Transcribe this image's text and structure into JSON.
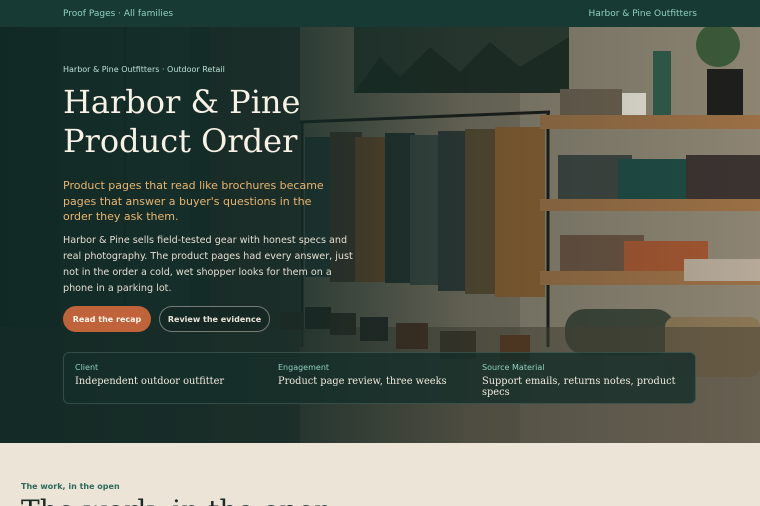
{
  "topbar": {
    "left_link": "Proof Pages · All families",
    "right_link": "Harbor & Pine Outfitters"
  },
  "hero": {
    "eyebrow": "Harbor & Pine Outfitters · Outdoor Retail",
    "title": "Harbor & Pine Product Order",
    "lede": "Product pages that read like brochures became pages that answer a buyer's questions in the order they ask them.",
    "body": "Harbor & Pine sells field-tested gear with honest specs and real photography. The product pages had every answer, just not in the order a cold, wet shopper looks for them on a phone in a parking lot.",
    "primary_button": "Read the recap",
    "secondary_button": "Review the evidence"
  },
  "facts": [
    {
      "label": "Client",
      "value": "Independent outdoor outfitter"
    },
    {
      "label": "Engagement",
      "value": "Product page review, three weeks"
    },
    {
      "label": "Source Material",
      "value": "Support emails, returns notes, product specs"
    }
  ],
  "section": {
    "kicker": "The work, in the open",
    "title": "The work, in the open"
  },
  "colors": {
    "topbar": "#183a35",
    "accent_orange": "#c0633b",
    "lede_gold": "#e9b56e",
    "teal_text": "#8fd1bf",
    "page_bg": "#ece4d6"
  },
  "images": {
    "hero_background": "store-interior-photo"
  }
}
